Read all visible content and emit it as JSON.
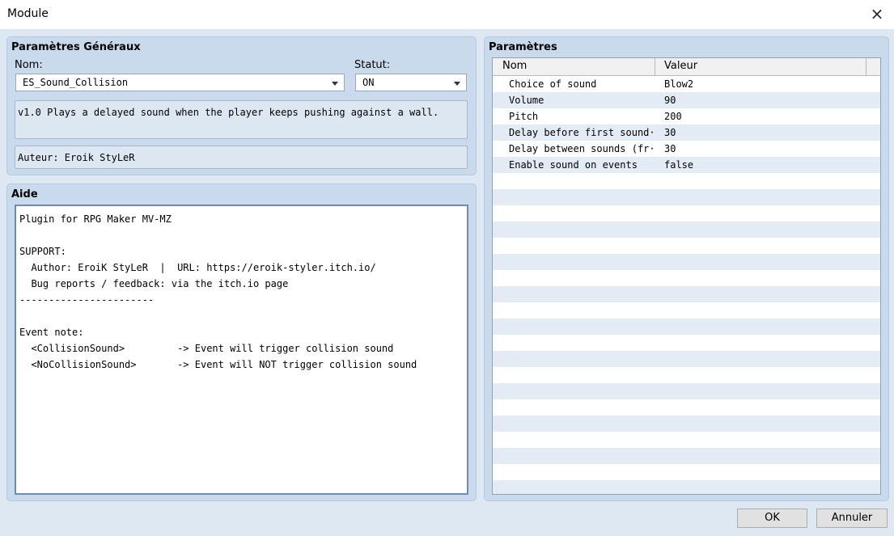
{
  "window": {
    "title": "Module",
    "close_icon": "×"
  },
  "general": {
    "title": "Paramètres Généraux",
    "name_label": "Nom:",
    "name_value": "ES_Sound_Collision",
    "status_label": "Statut:",
    "status_value": "ON",
    "description": "v1.0 Plays a delayed sound when the player keeps pushing against a wall.",
    "author": "Auteur: Eroik StyLeR"
  },
  "help": {
    "title": "Aide",
    "text": "Plugin for RPG Maker MV-MZ\n\nSUPPORT:\n  Author: EroiK StyLeR  |  URL: https://eroik-styler.itch.io/\n  Bug reports / feedback: via the itch.io page\n-----------------------\n\nEvent note:\n  <CollisionSound>         -> Event will trigger collision sound\n  <NoCollisionSound>       -> Event will NOT trigger collision sound"
  },
  "params": {
    "title": "Paramètres",
    "col_name": "Nom",
    "col_value": "Valeur",
    "rows": [
      {
        "name": "Choice of sound",
        "value": "Blow2"
      },
      {
        "name": "Volume",
        "value": "90"
      },
      {
        "name": "Pitch",
        "value": "200"
      },
      {
        "name": "Delay before first sound···",
        "value": "30"
      },
      {
        "name": "Delay between sounds (fr···",
        "value": "30"
      },
      {
        "name": "Enable sound on events",
        "value": "false"
      }
    ]
  },
  "buttons": {
    "ok": "OK",
    "cancel": "Annuler"
  }
}
